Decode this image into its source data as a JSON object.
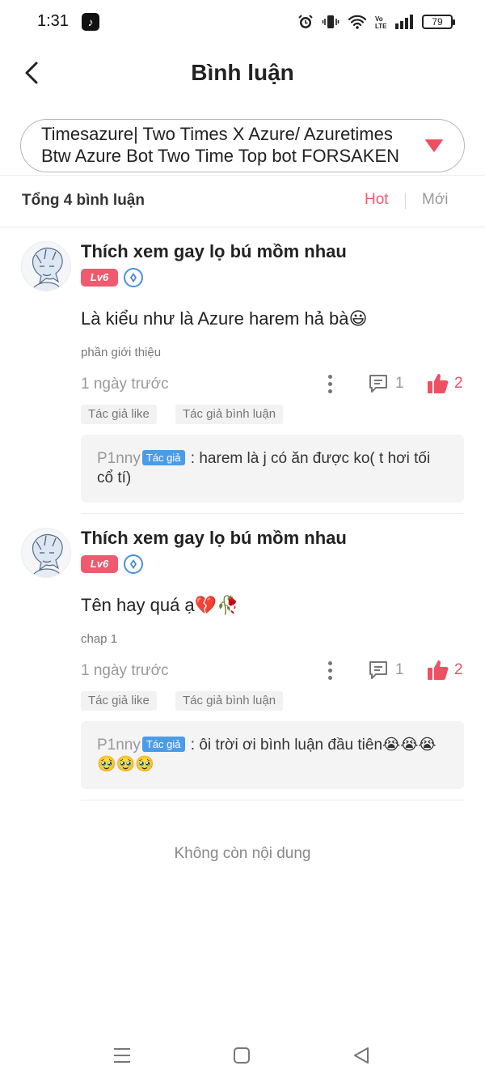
{
  "status_bar": {
    "time": "1:31",
    "battery": "79"
  },
  "header": {
    "title": "Bình luận"
  },
  "chapter_selector": {
    "text": "Timesazure| Two Times X Azure/ Azuretimes Btw Azure Bot Two Time Top bot FORSAKEN"
  },
  "list_header": {
    "total": "Tổng 4 bình luận",
    "sort_hot": "Hot",
    "sort_new": "Mới"
  },
  "comments": [
    {
      "username": "Thích xem gay lọ bú mồm nhau",
      "level": "Lv6",
      "text": "Là kiểu như là Azure harem hả bà😃",
      "chapter": "phần giới thiệu",
      "time": "1 ngày trước",
      "reply_count": "1",
      "like_count": "2",
      "tags": [
        "Tác giả like",
        "Tác giả bình luận"
      ],
      "reply": {
        "author": "P1nny",
        "badge": "Tác giả",
        "text": " : harem là j có ăn được ko( t hơi tối cổ tí)"
      }
    },
    {
      "username": "Thích xem gay lọ bú mồm nhau",
      "level": "Lv6",
      "text": "Tên hay quá ạ💔🥀",
      "chapter": "chap 1",
      "time": "1 ngày trước",
      "reply_count": "1",
      "like_count": "2",
      "tags": [
        "Tác giả like",
        "Tác giả bình luận"
      ],
      "reply": {
        "author": "P1nny",
        "badge": "Tác giả",
        "text": " : ôi trời ơi bình luận đầu tiên😭😭😭🥹🥹🥹"
      }
    }
  ],
  "end_message": "Không còn nội dung",
  "colors": {
    "accent": "#ef5a6f",
    "author_badge": "#4b9ce8"
  }
}
